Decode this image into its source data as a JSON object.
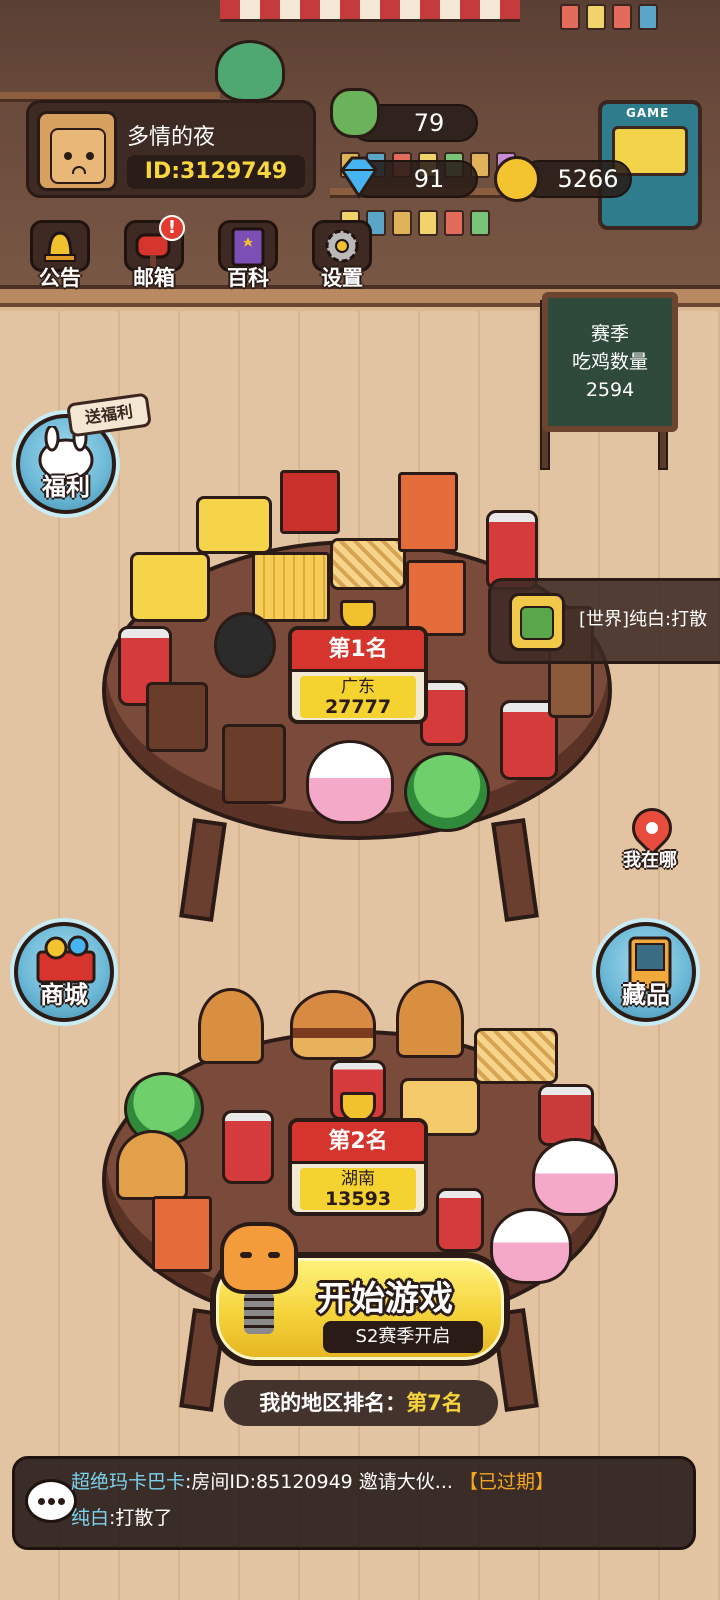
{
  "profile": {
    "name": "多情的夜",
    "id": "ID:3129749"
  },
  "currencies": {
    "energy": "79",
    "diamond": "91",
    "gold": "5266"
  },
  "menu": [
    {
      "label": "公告",
      "icon": "bell-icon"
    },
    {
      "label": "邮箱",
      "icon": "mailbox-icon",
      "badge": "!"
    },
    {
      "label": "百科",
      "icon": "book-icon"
    },
    {
      "label": "设置",
      "icon": "gear-icon"
    }
  ],
  "arcade_text": "GAME",
  "board": {
    "line1": "赛季",
    "line2": "吃鸡数量",
    "line3": "2594"
  },
  "side": {
    "welfare": "福利",
    "welfare_tag": "送福利",
    "where": "我在哪",
    "shop": "商城",
    "collection": "藏品"
  },
  "world_chat": {
    "channel": "[世界]",
    "user": "纯白",
    "text": ":打散"
  },
  "rankings": [
    {
      "place": "第1名",
      "region": "广东",
      "value": "27777"
    },
    {
      "place": "第2名",
      "region": "湖南",
      "value": "13593"
    }
  ],
  "start": {
    "title": "开始游戏",
    "subtitle": "S2赛季开启"
  },
  "my_rank": {
    "label": "我的地区排名：",
    "value": "第7名"
  },
  "chat": [
    {
      "user": "超绝玛卡巴卡",
      "text": ":房间ID:85120949 邀请大伙...",
      "tag": "【已过期】"
    },
    {
      "user": "纯白",
      "text": ":打散了",
      "tag": ""
    }
  ],
  "colors": {
    "accent_yellow": "#f6d33b",
    "rank_red": "#d6352d",
    "floor": "#e2c3a2",
    "table": "#7a4a3a"
  }
}
